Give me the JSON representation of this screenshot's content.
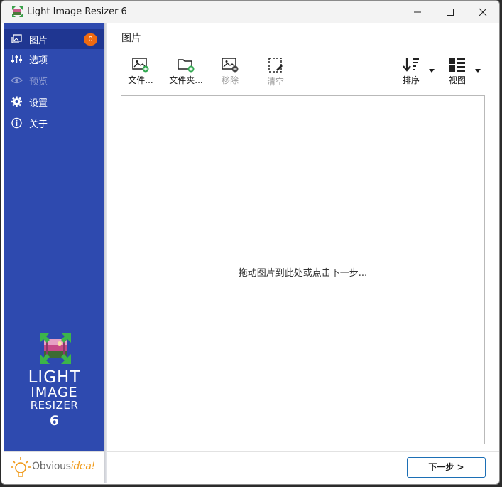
{
  "window": {
    "title": "Light Image Resizer 6",
    "controls": {
      "minimize": "minimize-icon",
      "maximize": "maximize-icon",
      "close": "close-icon"
    }
  },
  "sidebar": {
    "items": [
      {
        "label": "图片",
        "icon": "pictures-icon",
        "badge": "0",
        "active": true
      },
      {
        "label": "选项",
        "icon": "sliders-icon"
      },
      {
        "label": "预览",
        "icon": "eye-icon",
        "disabled": true
      },
      {
        "label": "设置",
        "icon": "gear-icon"
      },
      {
        "label": "关于",
        "icon": "info-icon"
      }
    ],
    "logo": {
      "line1": "LIGHT",
      "line2": "IMAGE",
      "line3": "RESIZER",
      "line4": "6"
    },
    "brand": {
      "part1": "Obvious",
      "part2": "idea!"
    }
  },
  "main": {
    "title": "图片",
    "toolbar": {
      "add_files": "文件...",
      "add_folder": "文件夹...",
      "remove": "移除",
      "clear": "清空",
      "sort": "排序",
      "view": "视图"
    },
    "drop_hint": "拖动图片到此处或点击下一步...",
    "next_button": "下一步 >"
  },
  "colors": {
    "sidebar_bg": "#2e4aaf",
    "sidebar_active": "#1f3691",
    "badge": "#f06a11",
    "accent_button_border": "#1c6fb5",
    "brand_accent": "#f09b1c"
  }
}
